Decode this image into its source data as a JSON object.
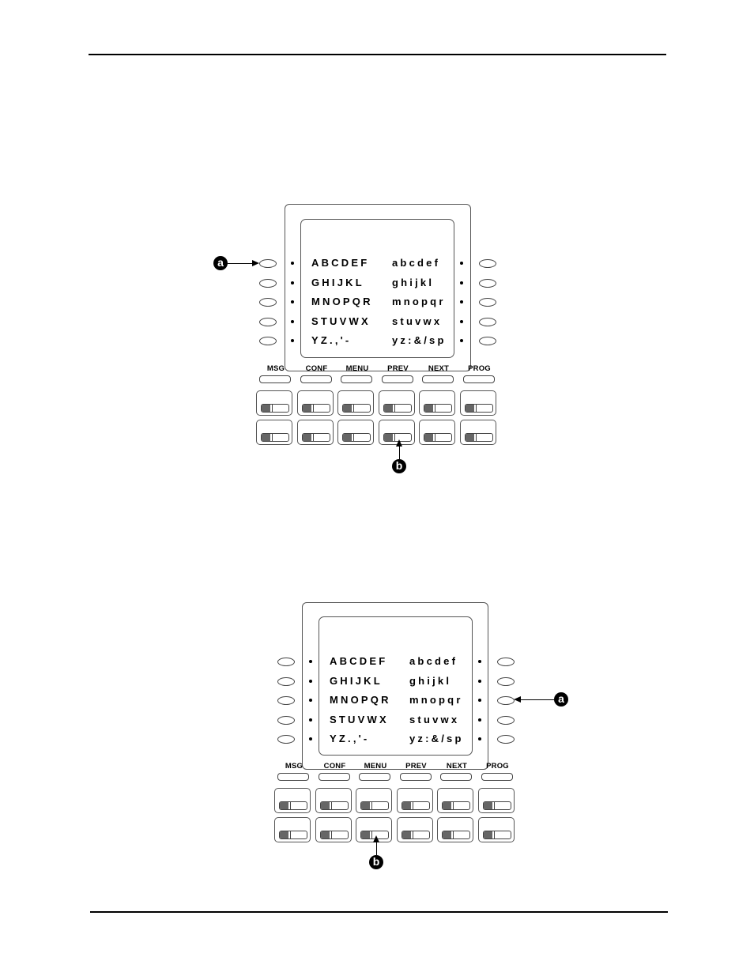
{
  "figures": [
    {
      "id": "figure-1",
      "display_rows": [
        {
          "upper": "ABCDEF",
          "lower": "abcdef"
        },
        {
          "upper": "GHIJKL",
          "lower": "ghijkl"
        },
        {
          "upper": "MNOPQR",
          "lower": "mnopqr"
        },
        {
          "upper": "STUVWX",
          "lower": "stuvwx"
        },
        {
          "upper": "YZ.,'-",
          "lower": "yz:&/sp"
        }
      ],
      "function_keys": [
        "MSG",
        "CONF",
        "MENU",
        "PREV",
        "NEXT",
        "PROG"
      ],
      "callouts": {
        "a": {
          "label": "a",
          "points_to": "left softkey row 1"
        },
        "b": {
          "label": "b",
          "points_to": "line key row 2, column 4"
        }
      }
    },
    {
      "id": "figure-2",
      "display_rows": [
        {
          "upper": "ABCDEF",
          "lower": "abcdef"
        },
        {
          "upper": "GHIJKL",
          "lower": "ghijkl"
        },
        {
          "upper": "MNOPQR",
          "lower": "mnopqr"
        },
        {
          "upper": "STUVWX",
          "lower": "stuvwx"
        },
        {
          "upper": "YZ.,'-",
          "lower": "yz:&/sp"
        }
      ],
      "function_keys": [
        "MSG",
        "CONF",
        "MENU",
        "PREV",
        "NEXT",
        "PROG"
      ],
      "callouts": {
        "a": {
          "label": "a",
          "points_to": "right softkey row 3"
        },
        "b": {
          "label": "b",
          "points_to": "line key row 2, column 3"
        }
      }
    }
  ]
}
